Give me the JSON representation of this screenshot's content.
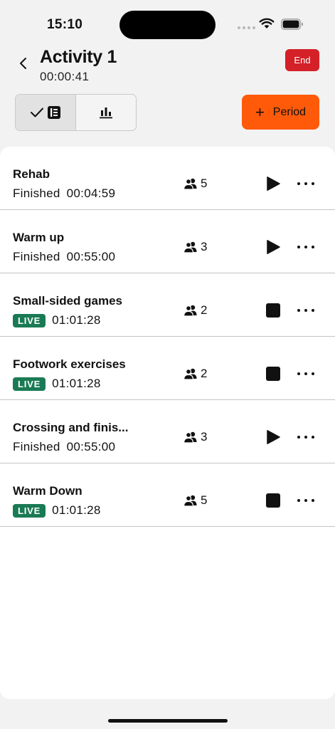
{
  "status_bar": {
    "time": "15:10"
  },
  "header": {
    "title": "Activity 1",
    "elapsed": "00:00:41",
    "end_label": "End"
  },
  "toolbar": {
    "period_label": "Period"
  },
  "periods": [
    {
      "name": "Rehab",
      "state": "finished",
      "status": "Finished",
      "time": "00:04:59",
      "people": "5"
    },
    {
      "name": "Warm up",
      "state": "finished",
      "status": "Finished",
      "time": "00:55:00",
      "people": "3"
    },
    {
      "name": "Small-sided games",
      "state": "live",
      "status": "LIVE",
      "time": "01:01:28",
      "people": "2"
    },
    {
      "name": "Footwork exercises",
      "state": "live",
      "status": "LIVE",
      "time": "01:01:28",
      "people": "2"
    },
    {
      "name": "Crossing and finis...",
      "state": "finished",
      "status": "Finished",
      "time": "00:55:00",
      "people": "3"
    },
    {
      "name": "Warm Down",
      "state": "live",
      "status": "LIVE",
      "time": "01:01:28",
      "people": "5"
    }
  ],
  "colors": {
    "accent": "#ff5a0a",
    "end": "#d42027",
    "live": "#1a7a54"
  }
}
